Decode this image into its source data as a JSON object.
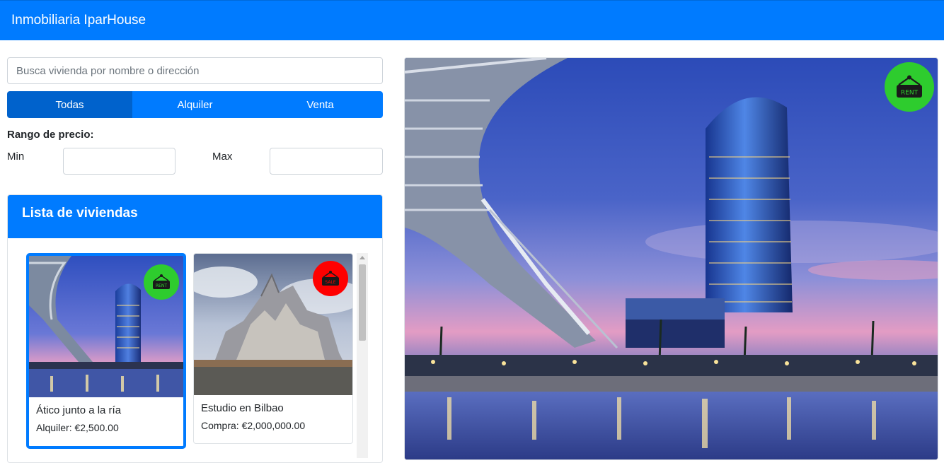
{
  "navbar": {
    "brand": "Inmobiliaria IparHouse"
  },
  "search": {
    "placeholder": "Busca vivienda por nombre o dirección",
    "value": ""
  },
  "filter_tabs": [
    {
      "label": "Todas",
      "active": true
    },
    {
      "label": "Alquiler",
      "active": false
    },
    {
      "label": "Venta",
      "active": false
    }
  ],
  "price_range": {
    "label": "Rango de precio:",
    "min_label": "Min",
    "max_label": "Max",
    "min_value": "",
    "max_value": ""
  },
  "list": {
    "title": "Lista de viviendas",
    "items": [
      {
        "name": "Ático junto a la ría",
        "price": "Alquiler: €2,500.00",
        "badge": "rent-sign-icon",
        "badge_color": "#2ecc2e",
        "selected": true
      },
      {
        "name": "Estudio en Bilbao",
        "price": "Compra: €2,000,000.00",
        "badge": "sale-sign-icon",
        "badge_color": "#ff0000",
        "selected": false
      }
    ]
  },
  "detail": {
    "badge": "rent-sign-icon",
    "badge_color": "#2ecc2e"
  },
  "colors": {
    "primary": "#007bff",
    "primary_active": "#0062cc"
  }
}
